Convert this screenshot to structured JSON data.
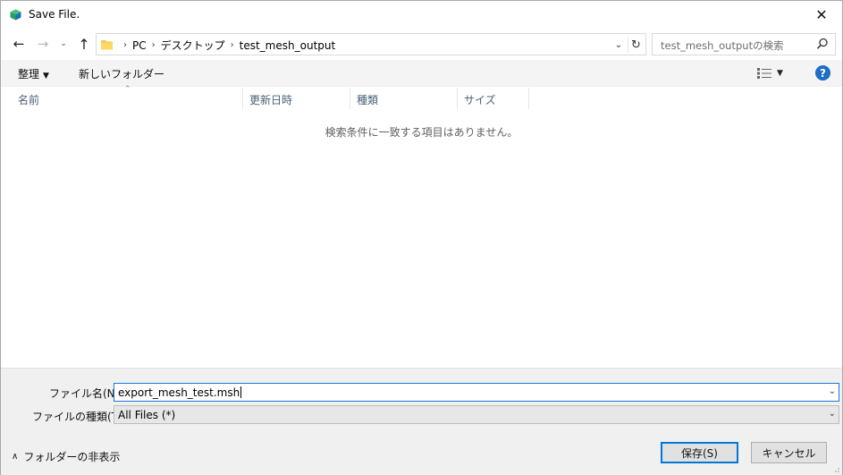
{
  "window": {
    "title": "Save File."
  },
  "address": {
    "crumbs": [
      "PC",
      "デスクトップ",
      "test_mesh_output"
    ]
  },
  "search": {
    "placeholder": "test_mesh_outputの検索"
  },
  "toolbar": {
    "organize_label": "整理",
    "new_folder_label": "新しいフォルダー"
  },
  "columns": {
    "name": "名前",
    "date": "更新日時",
    "type": "種類",
    "size": "サイズ"
  },
  "file_list": {
    "empty_message": "検索条件に一致する項目はありません。"
  },
  "footer": {
    "filename_label": "ファイル名(N):",
    "filename_value": "export_mesh_test.msh",
    "filetype_label": "ファイルの種類(T):",
    "filetype_value": "All Files (*)",
    "hide_folders_label": "フォルダーの非表示",
    "save_label": "保存(S)",
    "cancel_label": "キャンセル"
  },
  "colors": {
    "accent": "#0078d7",
    "help": "#1e6ec8",
    "column_header_text": "#4c607a"
  },
  "icons": [
    "app-icon",
    "close-icon",
    "back-arrow-icon",
    "forward-arrow-icon",
    "recent-chevron-icon",
    "up-arrow-icon",
    "folder-icon",
    "refresh-icon",
    "search-icon",
    "view-grid-icon",
    "help-icon"
  ]
}
